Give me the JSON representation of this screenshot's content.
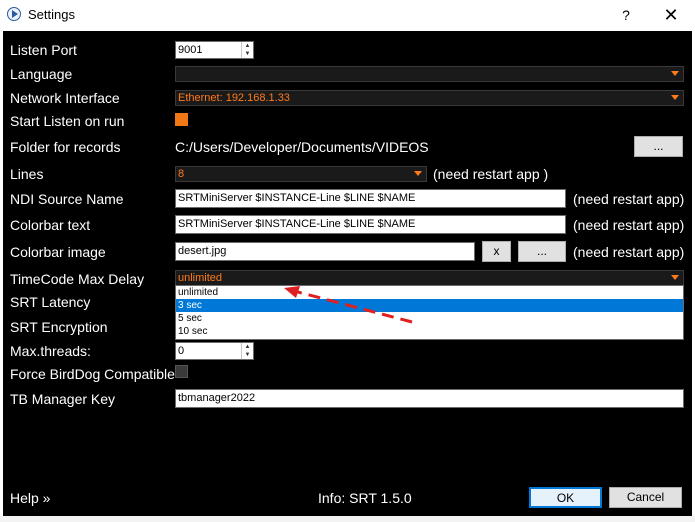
{
  "window": {
    "title": "Settings",
    "help_glyph": "?",
    "close_glyph": "✕"
  },
  "fields": {
    "listen_port": {
      "label": "Listen Port",
      "value": "9001"
    },
    "language": {
      "label": "Language",
      "value": ""
    },
    "network_interface": {
      "label": "Network Interface",
      "value": "Ethernet: 192.168.1.33"
    },
    "start_listen": {
      "label": "Start Listen on run",
      "checked": true
    },
    "folder": {
      "label": "Folder for records",
      "value": "C:/Users/Developer/Documents/VIDEOS",
      "browse_label": "..."
    },
    "lines": {
      "label": "Lines",
      "value": "8",
      "note": "(need restart app )"
    },
    "ndi_source": {
      "label": "NDI Source Name",
      "value": "SRTMiniServer $INSTANCE-Line $LINE $NAME",
      "note": "(need restart app)"
    },
    "colorbar_text": {
      "label": "Colorbar text",
      "value": "SRTMiniServer $INSTANCE-Line $LINE $NAME",
      "note": "(need restart app)"
    },
    "colorbar_image": {
      "label": "Colorbar image",
      "value": "desert.jpg",
      "clear_label": "x",
      "browse_label": "...",
      "note": "(need restart app)"
    },
    "timecode": {
      "label": "TimeCode Max Delay",
      "value": "unlimited",
      "options": [
        "unlimited",
        "3 sec",
        "5 sec",
        "10 sec"
      ],
      "highlighted_index": 1
    },
    "srt_latency": {
      "label": "SRT Latency"
    },
    "srt_encryption": {
      "label": "SRT Encryption"
    },
    "max_threads": {
      "label": "Max.threads:",
      "value": "0"
    },
    "birddog": {
      "label": "Force BirdDog Compatible",
      "checked": false
    },
    "tb_manager": {
      "label": "TB Manager Key",
      "value": "tbmanager2022"
    }
  },
  "footer": {
    "help_label": "Help »",
    "info": "Info: SRT 1.5.0",
    "ok_label": "OK",
    "cancel_label": "Cancel"
  },
  "colors": {
    "accent": "#f07816",
    "annotation_arrow": "#e02020",
    "selection": "#0078d7"
  }
}
